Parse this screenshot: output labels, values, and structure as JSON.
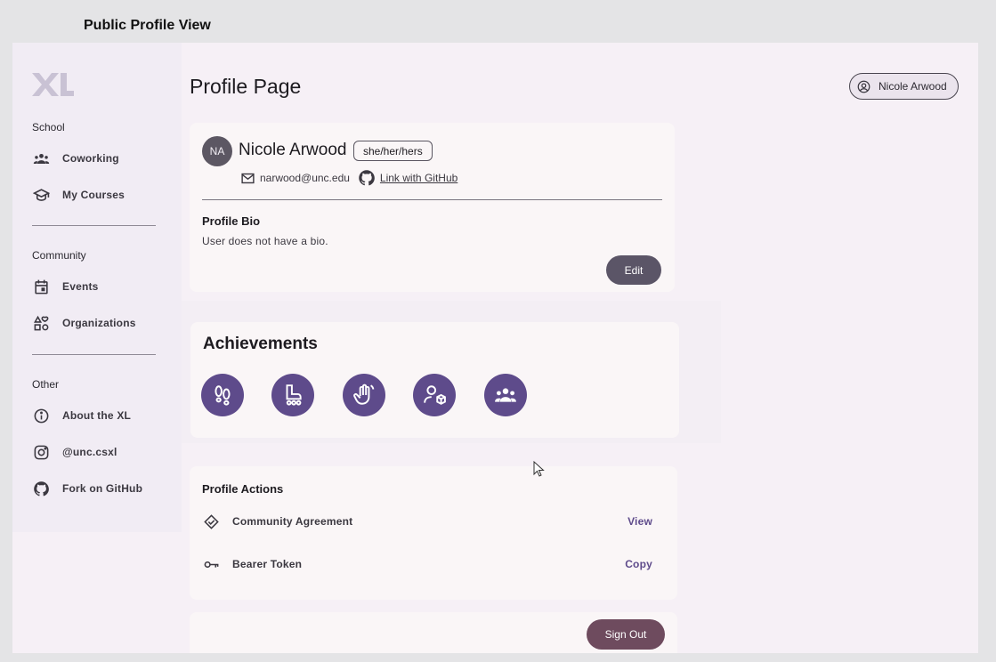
{
  "frame_label": "Public Profile View",
  "sidebar": {
    "sections": [
      {
        "title": "School",
        "items": [
          {
            "label": "Coworking",
            "icon": "group-icon"
          },
          {
            "label": "My Courses",
            "icon": "school-icon"
          }
        ]
      },
      {
        "title": "Community",
        "items": [
          {
            "label": "Events",
            "icon": "calendar-icon"
          },
          {
            "label": "Organizations",
            "icon": "category-icon"
          }
        ]
      },
      {
        "title": "Other",
        "items": [
          {
            "label": "About the XL",
            "icon": "info-icon"
          },
          {
            "label": "@unc.csxl",
            "icon": "instagram-icon"
          },
          {
            "label": "Fork on GitHub",
            "icon": "github-icon"
          }
        ]
      }
    ]
  },
  "header": {
    "title": "Profile Page",
    "user_chip": "Nicole Arwood"
  },
  "profile": {
    "initials": "NA",
    "name": "Nicole Arwood",
    "pronouns": "she/her/hers",
    "email": "narwood@unc.edu",
    "github_link": "Link with GitHub",
    "bio_title": "Profile Bio",
    "bio_text": "User does not have a bio.",
    "edit_label": "Edit"
  },
  "achievements": {
    "title": "Achievements",
    "badges": [
      "footprints-icon",
      "roller-skate-icon",
      "waving-hand-icon",
      "person-box-icon",
      "group-icon"
    ]
  },
  "actions": {
    "title": "Profile Actions",
    "rows": [
      {
        "label": "Community Agreement",
        "action": "View",
        "icon": "handshake-icon"
      },
      {
        "label": "Bearer Token",
        "action": "Copy",
        "icon": "key-icon"
      }
    ]
  },
  "sign_out_label": "Sign Out",
  "colors": {
    "accent": "#5e4b8b",
    "background": "#f6f0f6",
    "card": "#faf6f7",
    "sign_out": "#6e4b5e"
  }
}
